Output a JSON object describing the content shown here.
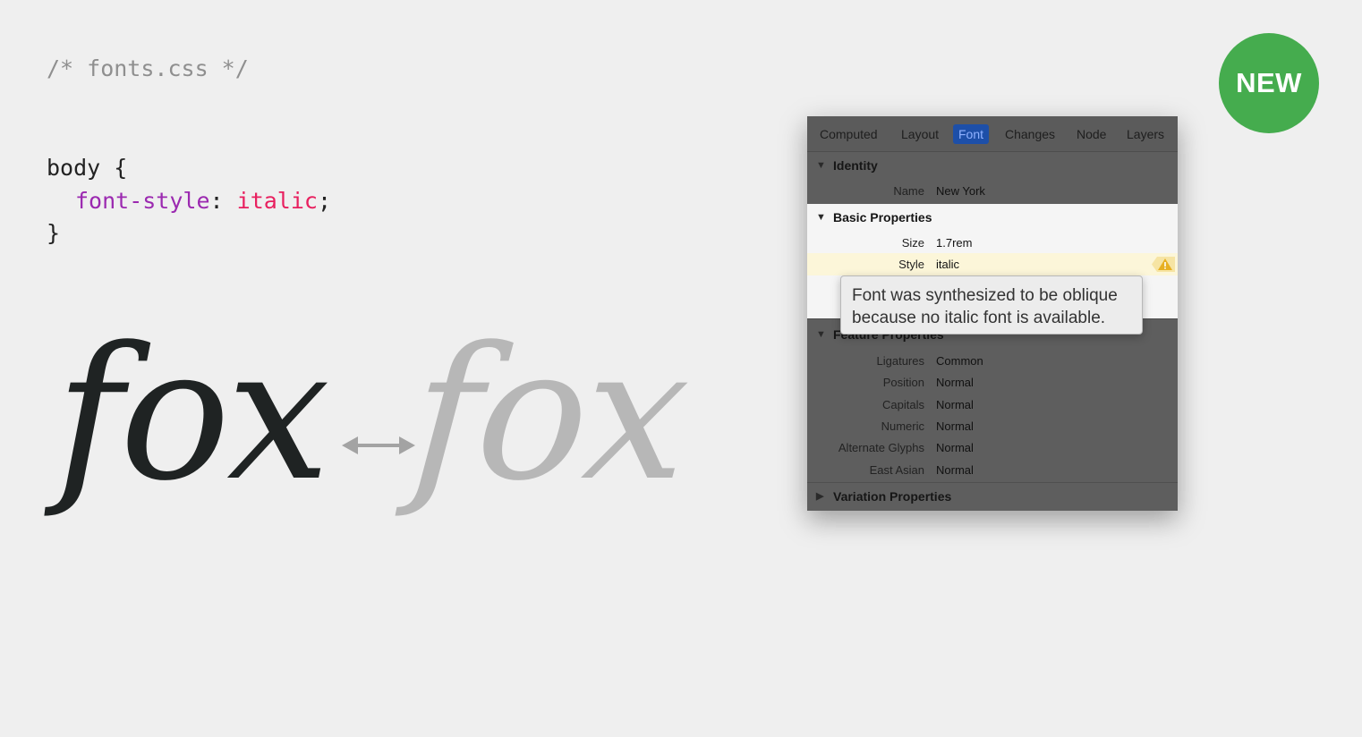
{
  "code": {
    "comment": "/* fonts.css */",
    "selector_line": "body {",
    "property": "font-style",
    "colon": ":",
    "value": "italic",
    "semicolon": ";",
    "close": "}"
  },
  "comparison": {
    "real_word": "fox",
    "synthesized_word": "fox",
    "arrow_icon": "double-arrow-icon"
  },
  "badge": {
    "label": "NEW",
    "color": "#45ac4e"
  },
  "inspector": {
    "tabs": [
      {
        "label": "Computed"
      },
      {
        "label": "Layout"
      },
      {
        "label": "Font"
      },
      {
        "label": "Changes"
      },
      {
        "label": "Node"
      },
      {
        "label": "Layers"
      }
    ],
    "active_tab": "Font",
    "identity": {
      "title": "Identity",
      "name_label": "Name",
      "name_value": "New York"
    },
    "basic": {
      "title": "Basic Properties",
      "size_label": "Size",
      "size_value": "1.7rem",
      "style_label": "Style",
      "style_value": "italic"
    },
    "feature": {
      "title": "Feature Properties",
      "rows": [
        {
          "label": "Ligatures",
          "value": "Common"
        },
        {
          "label": "Position",
          "value": "Normal"
        },
        {
          "label": "Capitals",
          "value": "Normal"
        },
        {
          "label": "Numeric",
          "value": "Normal"
        },
        {
          "label": "Alternate Glyphs",
          "value": "Normal"
        },
        {
          "label": "East Asian",
          "value": "Normal"
        }
      ]
    },
    "variation": {
      "title": "Variation Properties"
    },
    "tooltip": {
      "line1": "Font was synthesized to be oblique",
      "line2": "because no italic font is available."
    }
  }
}
